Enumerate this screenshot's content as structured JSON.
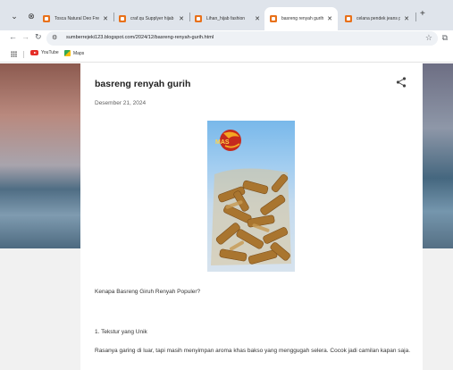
{
  "browser": {
    "tabs": [
      {
        "title": "Tosca Natural Deo Fres",
        "active": false
      },
      {
        "title": "craf.qu Supplyer hijab",
        "active": false
      },
      {
        "title": "Lihan_hijab fashion",
        "active": false
      },
      {
        "title": "basreng renyah gurih",
        "active": true
      },
      {
        "title": "celana pendek jeans p",
        "active": false
      }
    ],
    "url": "sumberrejeki123.blogspot.com/2024/12/basreng-renyah-gurih.html",
    "bookmarks": [
      {
        "label": "YouTube",
        "icon": "youtube-icon"
      },
      {
        "label": "Maps",
        "icon": "maps-icon"
      }
    ]
  },
  "post": {
    "title": "basreng renyah gurih",
    "date": "Desember 21, 2024",
    "image_logo_text": "MAS",
    "paragraphs": [
      "Kenapa Basreng Giruh Renyah Populer?",
      "1. Tekstur yang Unik",
      "Rasanya garing di luar, tapi masih menyimpan aroma khas bakso yang menggugah selera. Cocok jadi camilan kapan saja."
    ]
  },
  "colors": {
    "tabstrip": "#dfe4eb",
    "favicon": "#e8711a",
    "accent_orange": "#e8711a"
  }
}
